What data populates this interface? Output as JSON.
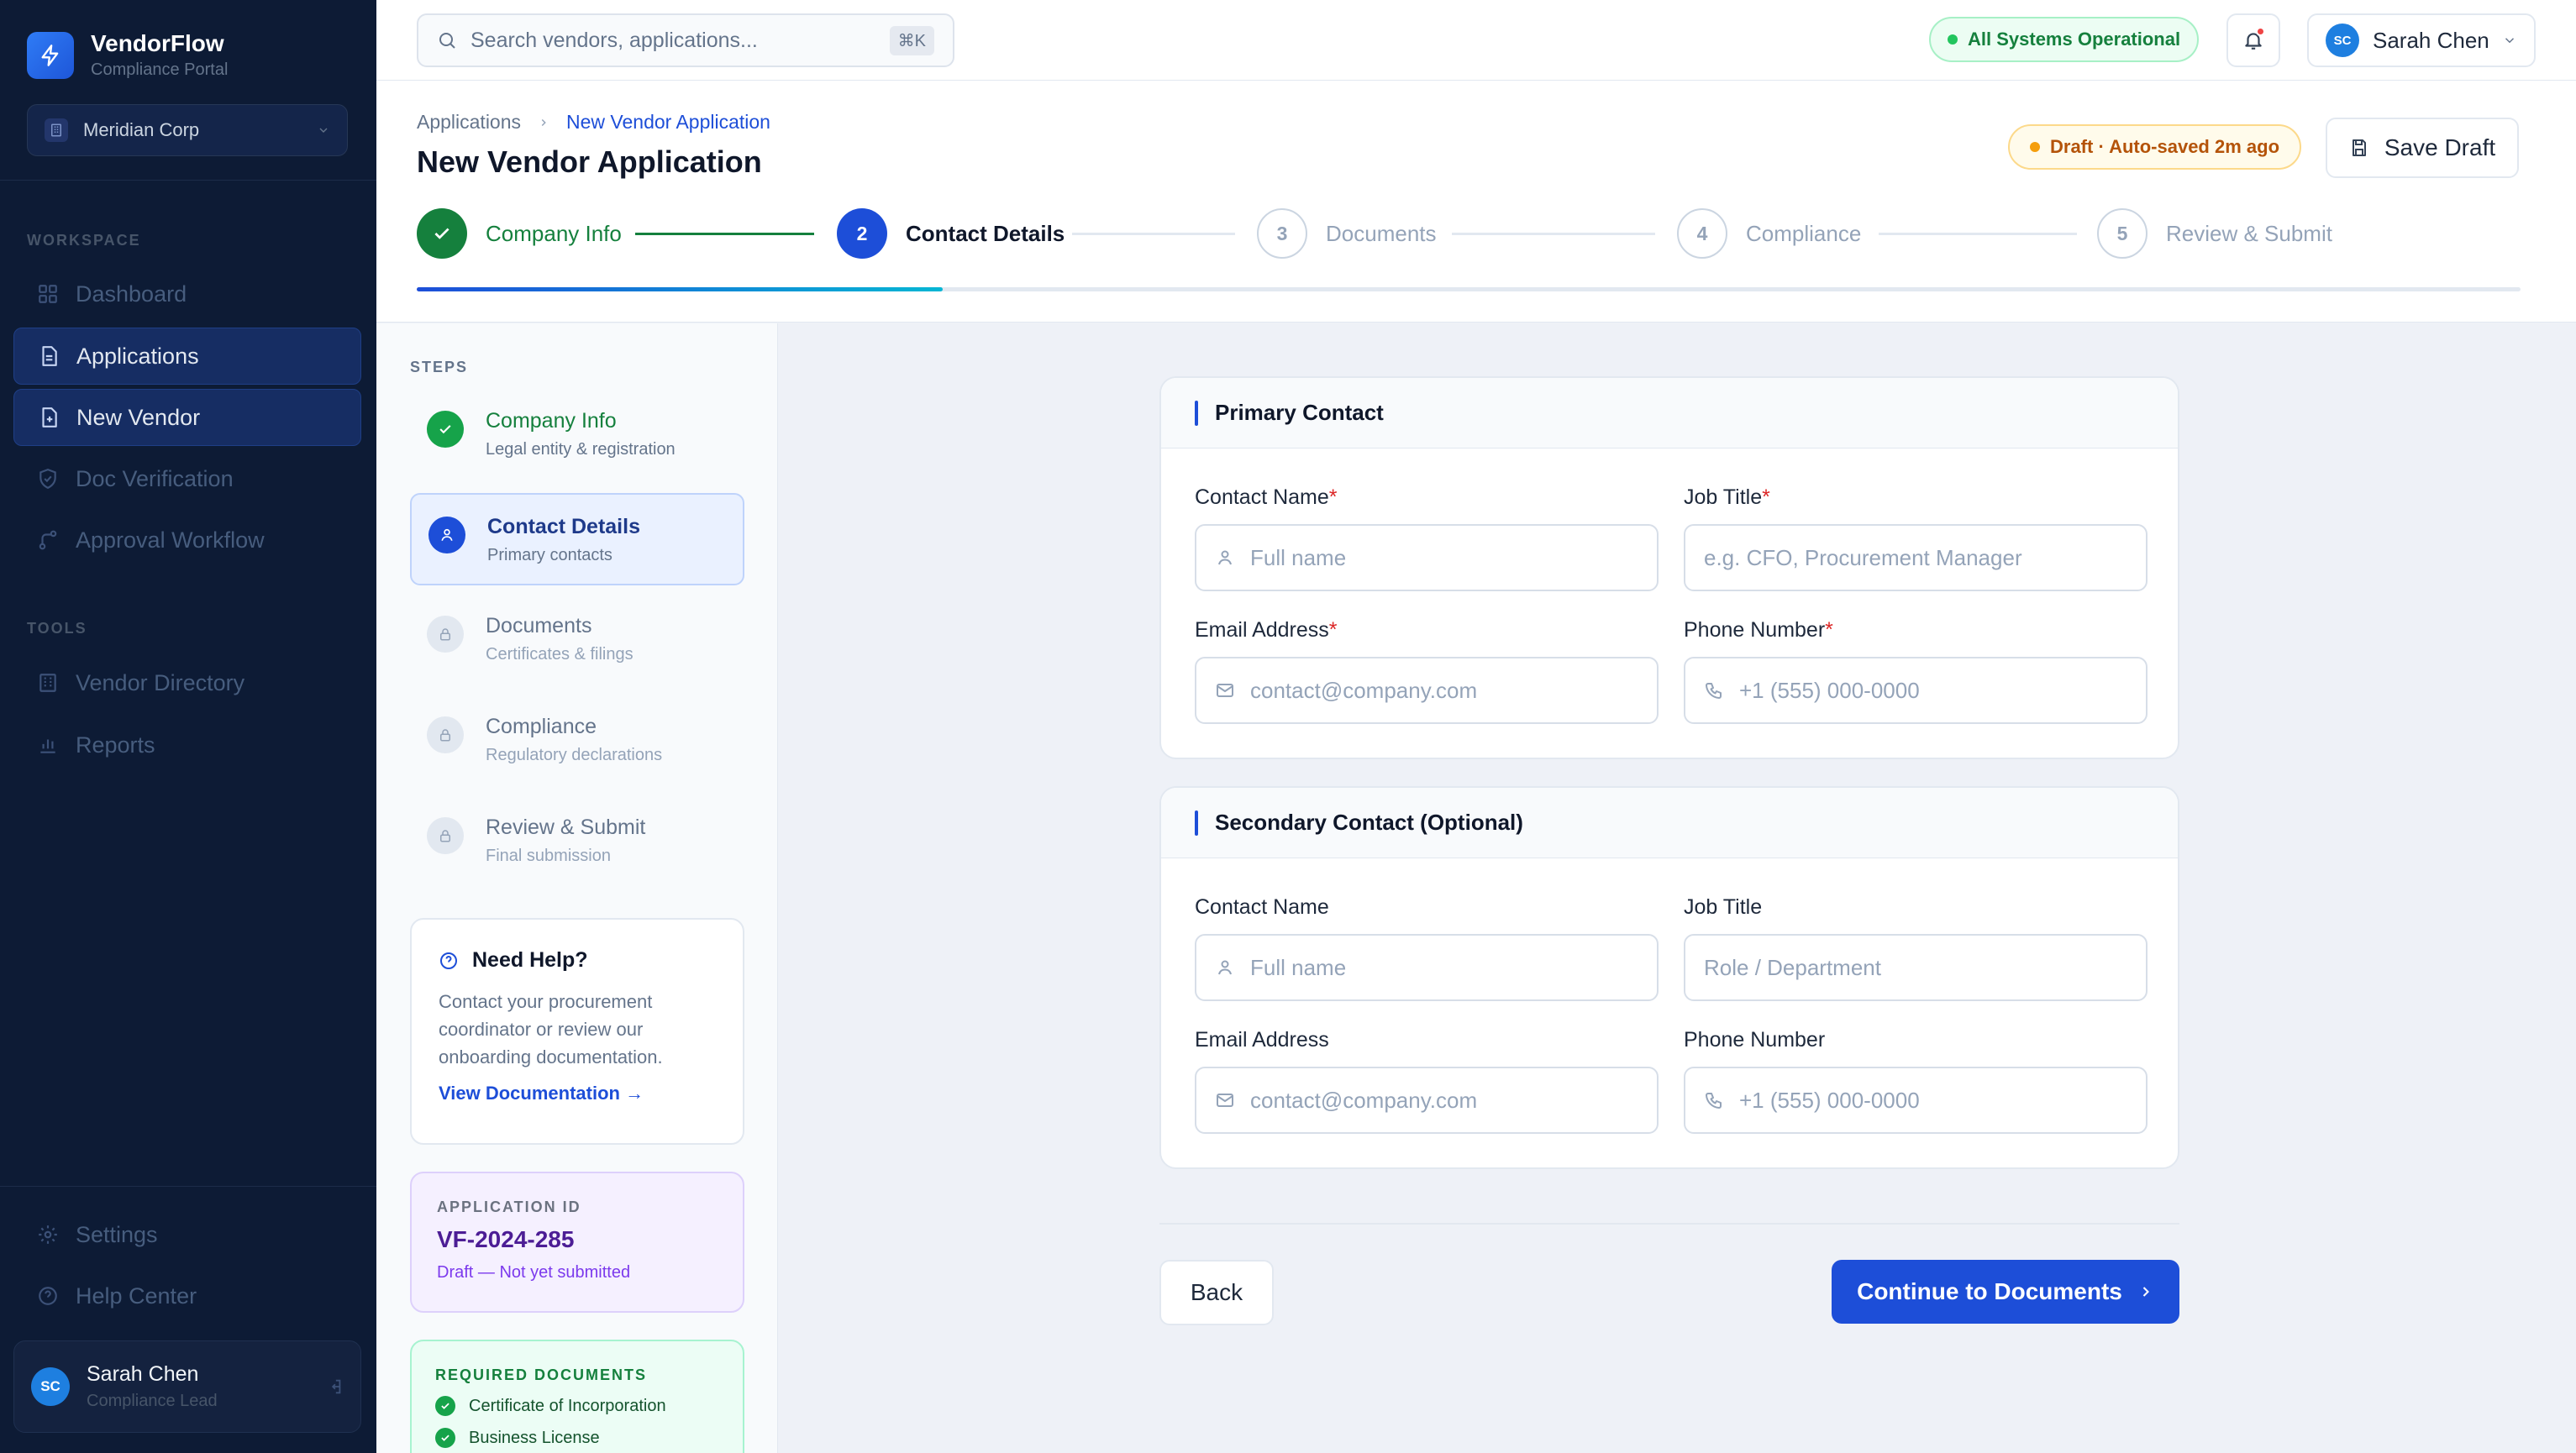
{
  "app": {
    "name": "VendorFlow",
    "subtitle": "Compliance Portal",
    "org": "Meridian Corp"
  },
  "sidebar": {
    "sections": {
      "workspace": "WORKSPACE",
      "tools": "TOOLS"
    },
    "items": [
      {
        "label": "Dashboard",
        "icon": "grid-icon"
      },
      {
        "label": "Applications",
        "icon": "document-icon"
      },
      {
        "label": "New Vendor",
        "icon": "add-document-icon"
      },
      {
        "label": "Doc Verification",
        "icon": "shield-check-icon"
      },
      {
        "label": "Approval Workflow",
        "icon": "workflow-icon"
      },
      {
        "label": "Vendor Directory",
        "icon": "building-icon"
      },
      {
        "label": "Reports",
        "icon": "bar-chart-icon"
      },
      {
        "label": "Settings",
        "icon": "gear-icon"
      },
      {
        "label": "Help Center",
        "icon": "help-circle-icon"
      }
    ],
    "user": {
      "initials": "SC",
      "name": "Sarah Chen",
      "role": "Compliance Lead"
    }
  },
  "topbar": {
    "search_placeholder": "Search vendors, applications...",
    "search_shortcut": "⌘K",
    "status": "All Systems Operational",
    "user": {
      "initials": "SC",
      "name": "Sarah Chen"
    }
  },
  "header": {
    "breadcrumb": [
      "Applications",
      "New Vendor Application"
    ],
    "title": "New Vendor Application",
    "draft_status": "Draft · Auto-saved 2m ago",
    "save_label": "Save Draft",
    "steps": [
      {
        "num": "1",
        "label": "Company Info",
        "state": "done"
      },
      {
        "num": "2",
        "label": "Contact Details",
        "state": "current"
      },
      {
        "num": "3",
        "label": "Documents",
        "state": "todo"
      },
      {
        "num": "4",
        "label": "Compliance",
        "state": "todo"
      },
      {
        "num": "5",
        "label": "Review & Submit",
        "state": "todo"
      }
    ],
    "progress_fraction": 0.25
  },
  "steps_panel": {
    "label": "STEPS",
    "items": [
      {
        "title": "Company Info",
        "sub": "Legal entity & registration",
        "state": "done"
      },
      {
        "title": "Contact Details",
        "sub": "Primary contacts",
        "state": "current"
      },
      {
        "title": "Documents",
        "sub": "Certificates & filings",
        "state": "todo"
      },
      {
        "title": "Compliance",
        "sub": "Regulatory declarations",
        "state": "todo"
      },
      {
        "title": "Review & Submit",
        "sub": "Final submission",
        "state": "todo"
      }
    ],
    "help": {
      "title": "Need Help?",
      "body": "Contact your procurement coordinator or review our onboarding documentation.",
      "link": "View Documentation →"
    },
    "application": {
      "label": "APPLICATION ID",
      "id": "VF-2024-285",
      "status": "Draft — Not yet submitted"
    },
    "required_docs": {
      "label": "REQUIRED DOCUMENTS",
      "items": [
        "Certificate of Incorporation",
        "Business License"
      ]
    }
  },
  "form": {
    "primary": {
      "title": "Primary Contact",
      "name_label": "Contact Name",
      "name_placeholder": "Full name",
      "job_label": "Job Title",
      "job_placeholder": "e.g. CFO, Procurement Manager",
      "email_label": "Email Address",
      "email_placeholder": "contact@company.com",
      "phone_label": "Phone Number",
      "phone_placeholder": "+1 (555) 000-0000",
      "required_mark": "*"
    },
    "secondary": {
      "title": "Secondary Contact (Optional)",
      "name_label": "Contact Name",
      "name_placeholder": "Full name",
      "job_label": "Job Title",
      "job_placeholder": "Role / Department",
      "email_label": "Email Address",
      "email_placeholder": "contact@company.com",
      "phone_label": "Phone Number",
      "phone_placeholder": "+1 (555) 000-0000"
    },
    "back_label": "Back",
    "continue_label": "Continue to Documents"
  },
  "colors": {
    "accent": "#1d4ed8",
    "success": "#15803d",
    "sidebar_bg": "#0d1b35",
    "warning": "#b45309"
  }
}
